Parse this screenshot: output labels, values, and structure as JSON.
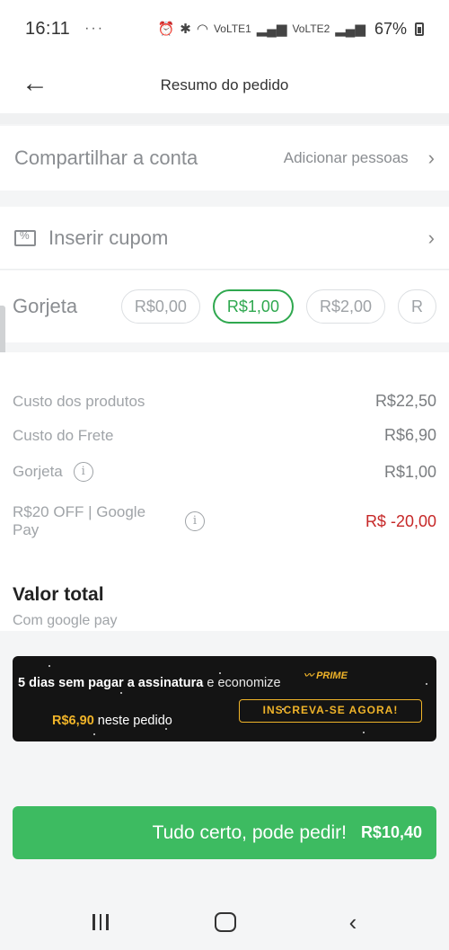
{
  "status_bar": {
    "time": "16:11",
    "overflow": "···",
    "net1": "VoLTE1",
    "net2": "VoLTE2",
    "battery": "67%"
  },
  "header": {
    "back_icon": "arrow-left-icon",
    "title": "Resumo do pedido"
  },
  "share": {
    "label": "Compartilhar a conta",
    "action": "Adicionar pessoas"
  },
  "coupon": {
    "label": "Inserir cupom"
  },
  "tip": {
    "label": "Gorjeta",
    "options": [
      "R$0,00",
      "R$1,00",
      "R$2,00",
      "R"
    ],
    "selected_index": 1
  },
  "summary": {
    "rows": [
      {
        "label": "Custo dos produtos",
        "value": "R$22,50"
      },
      {
        "label": "Custo do Frete",
        "value": "R$6,90"
      },
      {
        "label": "Gorjeta",
        "value": "R$1,00"
      },
      {
        "label": "R$20 OFF | Google Pay",
        "value": "R$ -20,00"
      }
    ],
    "total_label": "Valor total",
    "total_sub": "Com google pay"
  },
  "prime_banner": {
    "bold_text": "5 dias sem pagar a assinatura",
    "rest_text": " e economize",
    "badge": "PRIME",
    "amount": "R$6,90",
    "amount_suffix": " neste pedido",
    "cta": "INSCREVA-SE AGORA!"
  },
  "order_button": {
    "label": "Tudo certo, pode pedir!",
    "value": "R$10,40"
  },
  "colors": {
    "primary_green": "#3dbb61",
    "tip_selected": "#2fa84f",
    "discount_red": "#c62828",
    "prime_gold": "#f0b429"
  }
}
